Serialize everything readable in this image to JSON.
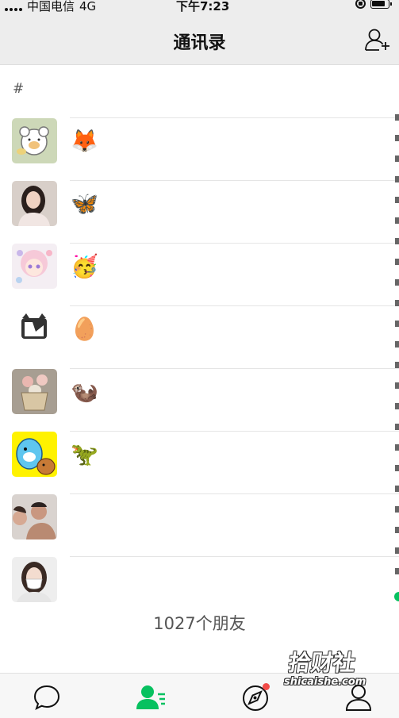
{
  "status_bar": {
    "carrier": "中国电信",
    "network": "4G",
    "time": "下午7:23"
  },
  "header": {
    "title": "通讯录",
    "add_icon": "add-friend-icon"
  },
  "section": {
    "letter": "#"
  },
  "contacts": [
    {
      "name": "🦊",
      "avatar": "cartoon-bear"
    },
    {
      "name": "🦋",
      "avatar": "girl-photo"
    },
    {
      "name": "🥳",
      "avatar": "anime-girl"
    },
    {
      "name": "🥚",
      "avatar": "black-white-cat"
    },
    {
      "name": "🦦",
      "avatar": "cat-in-basket"
    },
    {
      "name": "🦖",
      "avatar": "blue-dinosaur"
    },
    {
      "name": "",
      "avatar": "couple-photo"
    },
    {
      "name": "",
      "avatar": "masked-girl"
    }
  ],
  "footer": {
    "friend_count": "1027个朋友"
  },
  "tabs": [
    {
      "name": "chats",
      "icon": "chat-bubble-icon",
      "active": false
    },
    {
      "name": "contacts",
      "icon": "contacts-icon",
      "active": true
    },
    {
      "name": "discover",
      "icon": "compass-icon",
      "active": false,
      "badge": true
    },
    {
      "name": "me",
      "icon": "person-icon",
      "active": false
    }
  ],
  "watermark": {
    "text": "拾财社",
    "sub": "shicaishe.com"
  },
  "colors": {
    "accent": "#07c160",
    "background": "#ededed",
    "badge": "#f24b48"
  }
}
